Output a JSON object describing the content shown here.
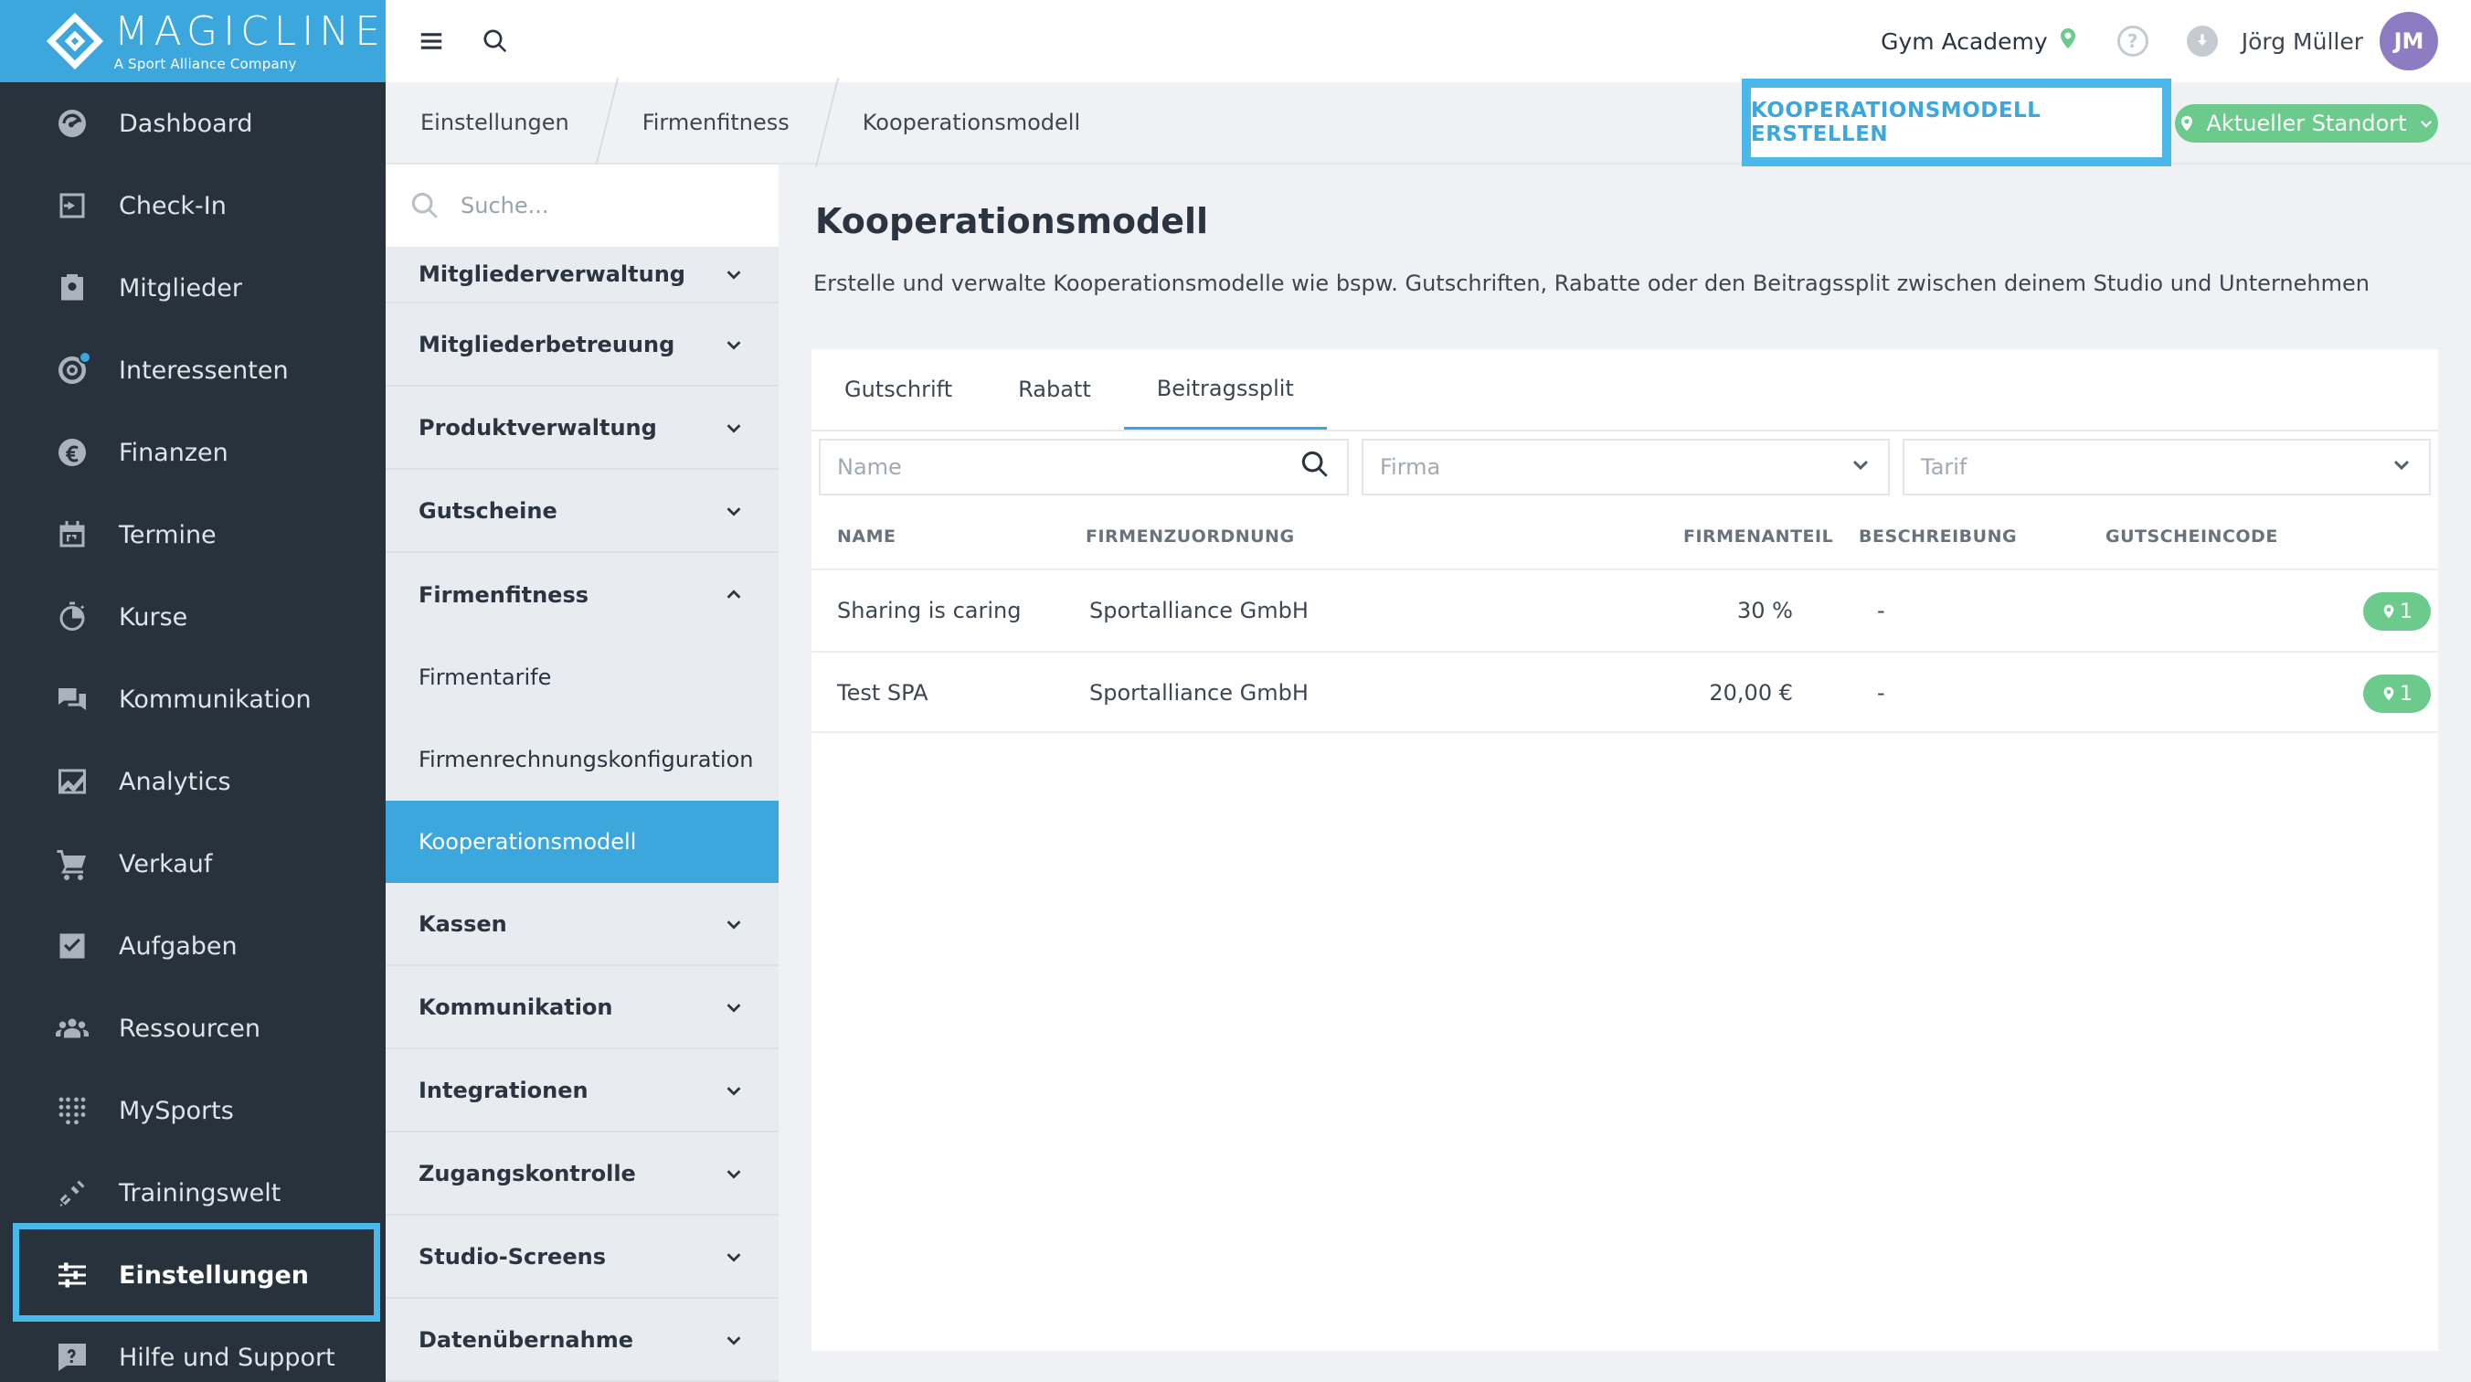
{
  "logo": {
    "name": "MAGICLINE",
    "subtitle": "A Sport Alliance Company"
  },
  "sidebar": {
    "items": [
      {
        "label": "Dashboard",
        "icon": "dashboard-icon"
      },
      {
        "label": "Check-In",
        "icon": "check-in-icon"
      },
      {
        "label": "Mitglieder",
        "icon": "members-icon"
      },
      {
        "label": "Interessenten",
        "icon": "prospects-icon"
      },
      {
        "label": "Finanzen",
        "icon": "euro-icon"
      },
      {
        "label": "Termine",
        "icon": "calendar-icon"
      },
      {
        "label": "Kurse",
        "icon": "stopwatch-icon"
      },
      {
        "label": "Kommunikation",
        "icon": "chat-icon"
      },
      {
        "label": "Analytics",
        "icon": "chart-icon"
      },
      {
        "label": "Verkauf",
        "icon": "cart-icon"
      },
      {
        "label": "Aufgaben",
        "icon": "checkbox-icon"
      },
      {
        "label": "Ressourcen",
        "icon": "group-icon"
      },
      {
        "label": "MySports",
        "icon": "dots-grid-icon"
      },
      {
        "label": "Trainingswelt",
        "icon": "dumbbell-icon"
      },
      {
        "label": "Einstellungen",
        "icon": "sliders-icon"
      },
      {
        "label": "Hilfe und Support",
        "icon": "help-chat-icon"
      }
    ],
    "active": "Einstellungen"
  },
  "topbar": {
    "studio": "Gym Academy",
    "user_name": "Jörg Müller",
    "avatar_initials": "JM"
  },
  "breadcrumb": [
    "Einstellungen",
    "Firmenfitness",
    "Kooperationsmodell"
  ],
  "actions": {
    "create_label": "KOOPERATIONSMODELL ERSTELLEN",
    "location_label": "Aktueller Standort"
  },
  "submenu": {
    "search_placeholder": "Suche...",
    "groups_top": [
      "Mitgliederverwaltung",
      "Mitgliederbetreuung",
      "Produktverwaltung",
      "Gutscheine"
    ],
    "open_group": "Firmenfitness",
    "children": [
      "Firmentarife",
      "Firmenrechnungskonfiguration",
      "Kooperationsmodell"
    ],
    "groups_bottom": [
      "Kassen",
      "Kommunikation",
      "Integrationen",
      "Zugangskontrolle",
      "Studio-Screens",
      "Datenübernahme"
    ]
  },
  "main": {
    "title": "Kooperationsmodell",
    "description": "Erstelle und verwalte Kooperationsmodelle wie bspw. Gutschriften, Rabatte oder den Beitragssplit zwischen deinem Studio und Unternehmen",
    "tabs": [
      "Gutschrift",
      "Rabatt",
      "Beitragssplit"
    ],
    "active_tab": "Beitragssplit",
    "filters": {
      "name_placeholder": "Name",
      "firma_placeholder": "Firma",
      "tarif_placeholder": "Tarif"
    },
    "columns": [
      "NAME",
      "FIRMENZUORDNUNG",
      "FIRMENANTEIL",
      "BESCHREIBUNG",
      "GUTSCHEINCODE"
    ],
    "rows": [
      {
        "name": "Sharing is caring",
        "company": "Sportalliance GmbH",
        "share": "30 %",
        "description": "-",
        "locations": "1"
      },
      {
        "name": "Test SPA",
        "company": "Sportalliance GmbH",
        "share": "20,00 €",
        "description": "-",
        "locations": "1"
      }
    ]
  },
  "colors": {
    "brand": "#3ba7dd",
    "sidebar": "#27323d",
    "success": "#6ccb8c",
    "avatar": "#8e7cc3"
  }
}
